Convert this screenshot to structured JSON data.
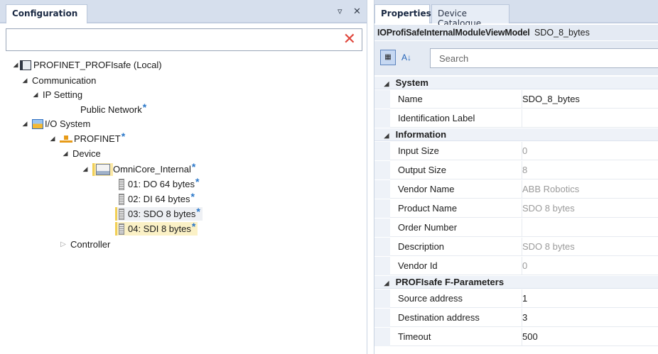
{
  "left_panel": {
    "tab_label": "Configuration",
    "pin_glyph": "▿",
    "close_glyph": "✕",
    "search_value": "",
    "clear_glyph": "✕",
    "tree": [
      {
        "label": "PROFINET_PROFIsafe (Local)",
        "starred": false
      },
      {
        "label": "Communication",
        "starred": false
      },
      {
        "label": "IP Setting",
        "starred": false
      },
      {
        "label": "Public Network",
        "starred": true
      },
      {
        "label": "I/O System",
        "starred": false
      },
      {
        "label": "PROFINET",
        "starred": true
      },
      {
        "label": "Device",
        "starred": false
      },
      {
        "label": "OmniCore_Internal",
        "starred": true
      },
      {
        "label": "01: DO 64 bytes",
        "starred": true
      },
      {
        "label": "02: DI 64 bytes",
        "starred": true
      },
      {
        "label": "03: SDO 8 bytes",
        "starred": true
      },
      {
        "label": "04: SDI 8 bytes",
        "starred": true
      },
      {
        "label": "Controller",
        "starred": false
      }
    ],
    "star_glyph": "*"
  },
  "right_panel": {
    "tabs": [
      "Properties",
      "Device Catalogue"
    ],
    "header_type": "IOProfiSafeInternalModuleViewModel",
    "header_name": "SDO_8_bytes",
    "search_placeholder": "Search",
    "categories": [
      {
        "name": "System",
        "rows": [
          {
            "name": "Name",
            "value": "SDO_8_bytes",
            "readonly": false
          },
          {
            "name": "Identification Label",
            "value": "",
            "readonly": false
          }
        ]
      },
      {
        "name": "Information",
        "rows": [
          {
            "name": "Input Size",
            "value": "0",
            "readonly": true
          },
          {
            "name": "Output Size",
            "value": "8",
            "readonly": true
          },
          {
            "name": "Vendor Name",
            "value": "ABB Robotics",
            "readonly": true
          },
          {
            "name": "Product Name",
            "value": "SDO 8 bytes",
            "readonly": true
          },
          {
            "name": "Order Number",
            "value": "",
            "readonly": true
          },
          {
            "name": "Description",
            "value": "SDO 8 bytes",
            "readonly": true
          },
          {
            "name": "Vendor Id",
            "value": "0",
            "readonly": true
          }
        ]
      },
      {
        "name": "PROFIsafe F-Parameters",
        "rows": [
          {
            "name": "Source address",
            "value": "1",
            "readonly": false
          },
          {
            "name": "Destination address",
            "value": "3",
            "readonly": false
          },
          {
            "name": "Timeout",
            "value": "500",
            "readonly": false
          }
        ]
      }
    ]
  }
}
